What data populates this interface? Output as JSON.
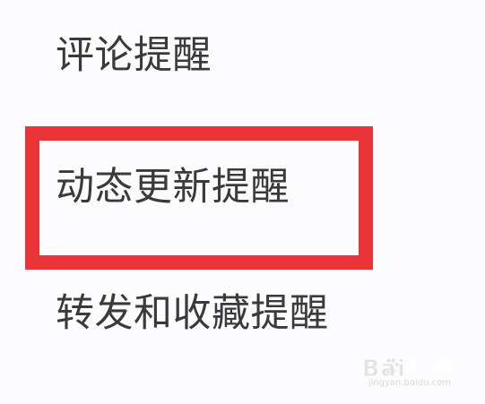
{
  "settings": {
    "items": [
      {
        "label": "评论提醒"
      },
      {
        "label": "动态更新提醒"
      },
      {
        "label": "转发和收藏提醒"
      }
    ]
  },
  "annotation": {
    "highlight_color": "#ea3437"
  },
  "watermark": {
    "logo": "Bai经验",
    "url": "jingyan.baidu.com"
  }
}
